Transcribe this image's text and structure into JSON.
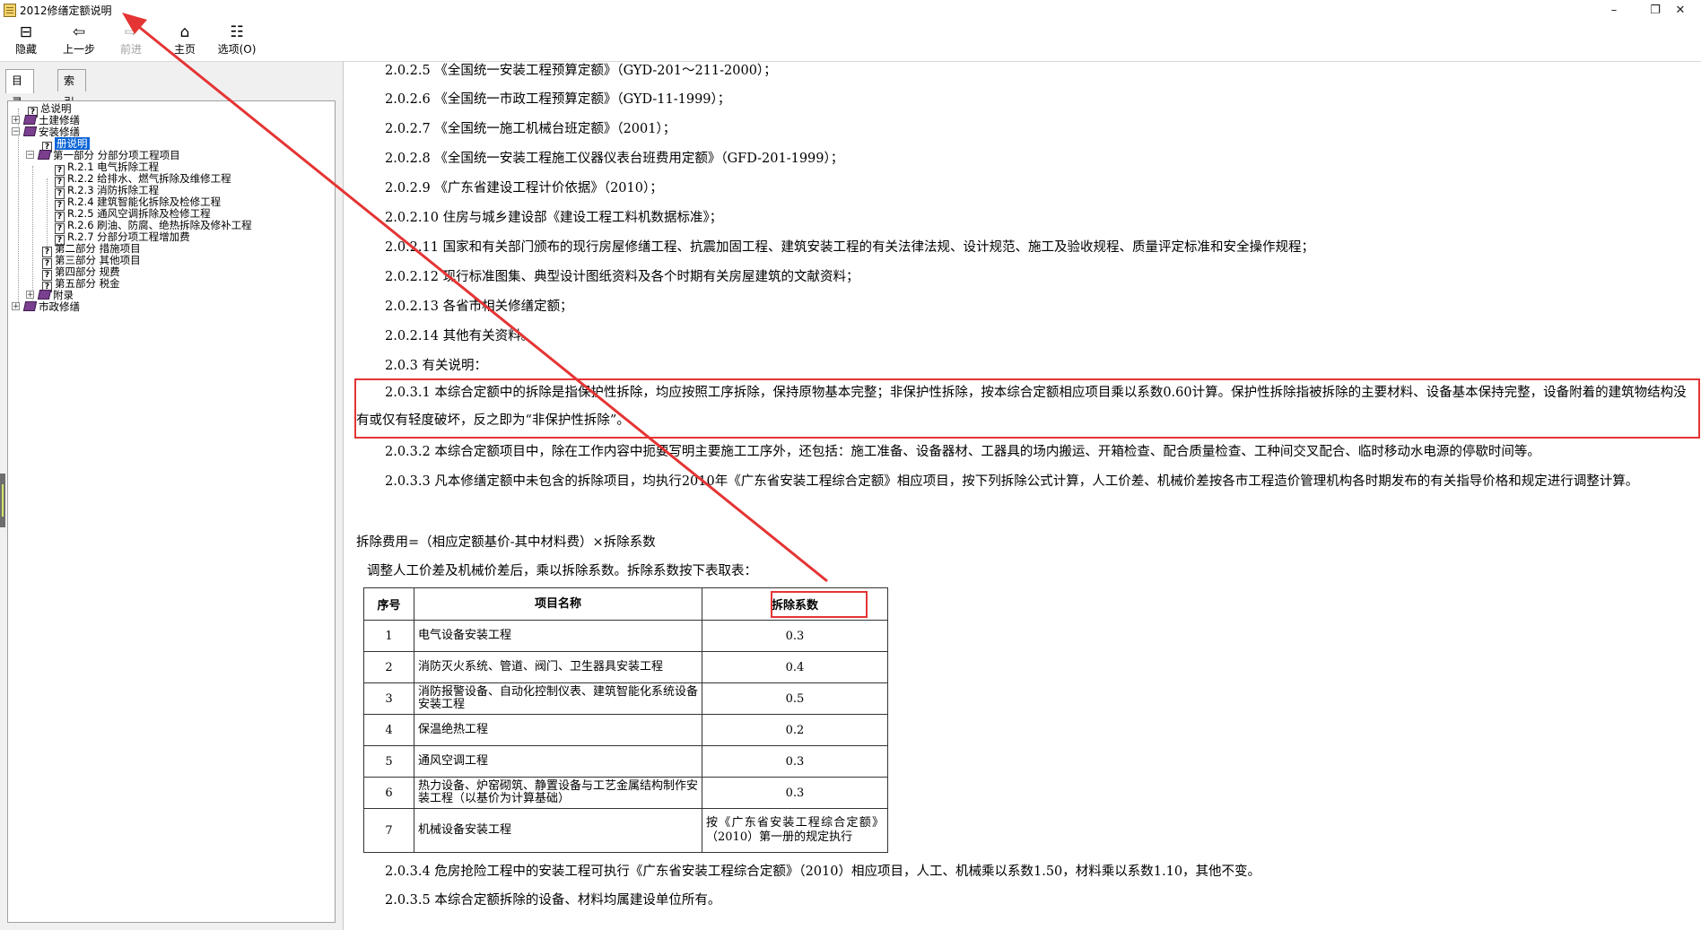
{
  "window": {
    "title": "2012修缮定额说明",
    "controls": [
      "–",
      "❐",
      "✕"
    ]
  },
  "toolbar": {
    "buttons": [
      {
        "label": "隐藏",
        "icon": "hide-pane-icon",
        "glyph": "⊟"
      },
      {
        "label": "上一步",
        "icon": "back-arrow-icon",
        "glyph": "⇦"
      },
      {
        "label": "前进",
        "icon": "forward-arrow-icon",
        "glyph": "⇨"
      },
      {
        "label": "主页",
        "icon": "home-icon",
        "glyph": "⌂"
      },
      {
        "label": "选项(O)",
        "icon": "options-icon",
        "glyph": "☷"
      }
    ]
  },
  "left_tabs": {
    "contents": "目录(C)",
    "index": "索引(N)"
  },
  "tree": [
    {
      "label": "总说明",
      "icon": "help-page-icon"
    },
    {
      "label": "土建修缮",
      "icon": "book-icon",
      "expander": "+"
    },
    {
      "label": "安装修缮",
      "icon": "open-book-icon",
      "expander": "−"
    },
    {
      "label": "册说明",
      "icon": "help-page-icon",
      "selected": true
    },
    {
      "label": "第一部分  分部分项工程项目",
      "icon": "open-book-icon",
      "expander": "−"
    },
    {
      "label": "R.2.1 电气拆除工程",
      "icon": "help-page-icon"
    },
    {
      "label": "R.2.2 给排水、燃气拆除及维修工程",
      "icon": "help-page-icon"
    },
    {
      "label": "R.2.3 消防拆除工程",
      "icon": "help-page-icon"
    },
    {
      "label": "R.2.4 建筑智能化拆除及检修工程",
      "icon": "help-page-icon"
    },
    {
      "label": "R.2.5 通风空调拆除及检修工程",
      "icon": "help-page-icon"
    },
    {
      "label": "R.2.6 刷油、防腐、绝热拆除及修补工程",
      "icon": "help-page-icon"
    },
    {
      "label": "R.2.7 分部分项工程增加费",
      "icon": "help-page-icon"
    },
    {
      "label": "第二部分  措施项目",
      "icon": "help-page-icon"
    },
    {
      "label": "第三部分  其他项目",
      "icon": "help-page-icon"
    },
    {
      "label": "第四部分  规费",
      "icon": "help-page-icon"
    },
    {
      "label": "第五部分  税金",
      "icon": "help-page-icon"
    },
    {
      "label": "附录",
      "icon": "book-icon",
      "expander": "+"
    },
    {
      "label": "市政修缮",
      "icon": "book-icon",
      "expander": "+"
    }
  ],
  "content": {
    "paras": [
      "2.0.2.5 《全国统一安装工程预算定额》（GYD-201～211-2000）；",
      "2.0.2.6 《全国统一市政工程预算定额》（GYD-11-1999）；",
      "2.0.2.7 《全国统一施工机械台班定额》（2001）；",
      "2.0.2.8 《全国统一安装工程施工仪器仪表台班费用定额》（GFD-201-1999）；",
      "2.0.2.9 《广东省建设工程计价依据》（2010）；",
      "2.0.2.10 住房与城乡建设部《建设工程工料机数据标准》；",
      "2.0.2.11 国家和有关部门颁布的现行房屋修缮工程、抗震加固工程、建筑安装工程的有关法律法规、设计规范、施工及验收规程、质量评定标准和安全操作规程；",
      "2.0.2.12 现行标准图集、典型设计图纸资料及各个时期有关房屋建筑的文献资料；",
      "2.0.2.13 各省市相关修缮定额；",
      "2.0.2.14 其他有关资料。",
      "2.0.3 有关说明："
    ],
    "p2031": "2.0.3.1 本综合定额中的拆除是指保护性拆除，均应按照工序拆除，保持原物基本完整；非保护性拆除，按本综合定额相应项目乘以系数0.60计算。保护性拆除指被拆除的主要材料、设备基本保持完整，设备附着的建筑物结构没有或仅有轻度破坏，反之即为“非保护性拆除”。",
    "p2032": "2.0.3.2 本综合定额项目中，除在工作内容中扼要写明主要施工工序外，还包括：施工准备、设备器材、工器具的场内搬运、开箱检查、配合质量检查、工种间交叉配合、临时移动水电源的停歇时间等。",
    "p2033": "2.0.3.3 凡本修缮定额中未包含的拆除项目，均执行2010年《广东省安装工程综合定额》相应项目，按下列拆除公式计算，人工价差、机械价差按各市工程造价管理机构各时期发布的有关指导价格和规定进行调整计算。",
    "formula": "拆除费用=（相应定额基价-其中材料费）×拆除系数",
    "table_intro": "调整人工价差及机械价差后，乘以拆除系数。拆除系数按下表取表：",
    "table": {
      "headers": [
        "序号",
        "项目名称",
        "拆除系数"
      ],
      "rows": [
        [
          "1",
          "电气设备安装工程",
          "0.3"
        ],
        [
          "2",
          "消防灭火系统、管道、阀门、卫生器具安装工程",
          "0.4"
        ],
        [
          "3",
          "消防报警设备、自动化控制仪表、建筑智能化系统设备安装工程",
          "0.5"
        ],
        [
          "4",
          "保温绝热工程",
          "0.2"
        ],
        [
          "5",
          "通风空调工程",
          "0.3"
        ],
        [
          "6",
          "热力设备、炉窑砌筑、静置设备与工艺金属结构制作安装工程（以基价为计算基础）",
          "0.3"
        ],
        [
          "7",
          "机械设备安装工程",
          "按《广东省安装工程综合定额》（2010）第一册的规定执行"
        ]
      ]
    },
    "p2034": "2.0.3.4 危房抢险工程中的安装工程可执行《广东省安装工程综合定额》（2010）相应项目，人工、机械乘以系数1.50，材料乘以系数1.10，其他不变。",
    "p2035": "2.0.3.5 本综合定额拆除的设备、材料均属建设单位所有。"
  },
  "annotation_color": "#e53434"
}
